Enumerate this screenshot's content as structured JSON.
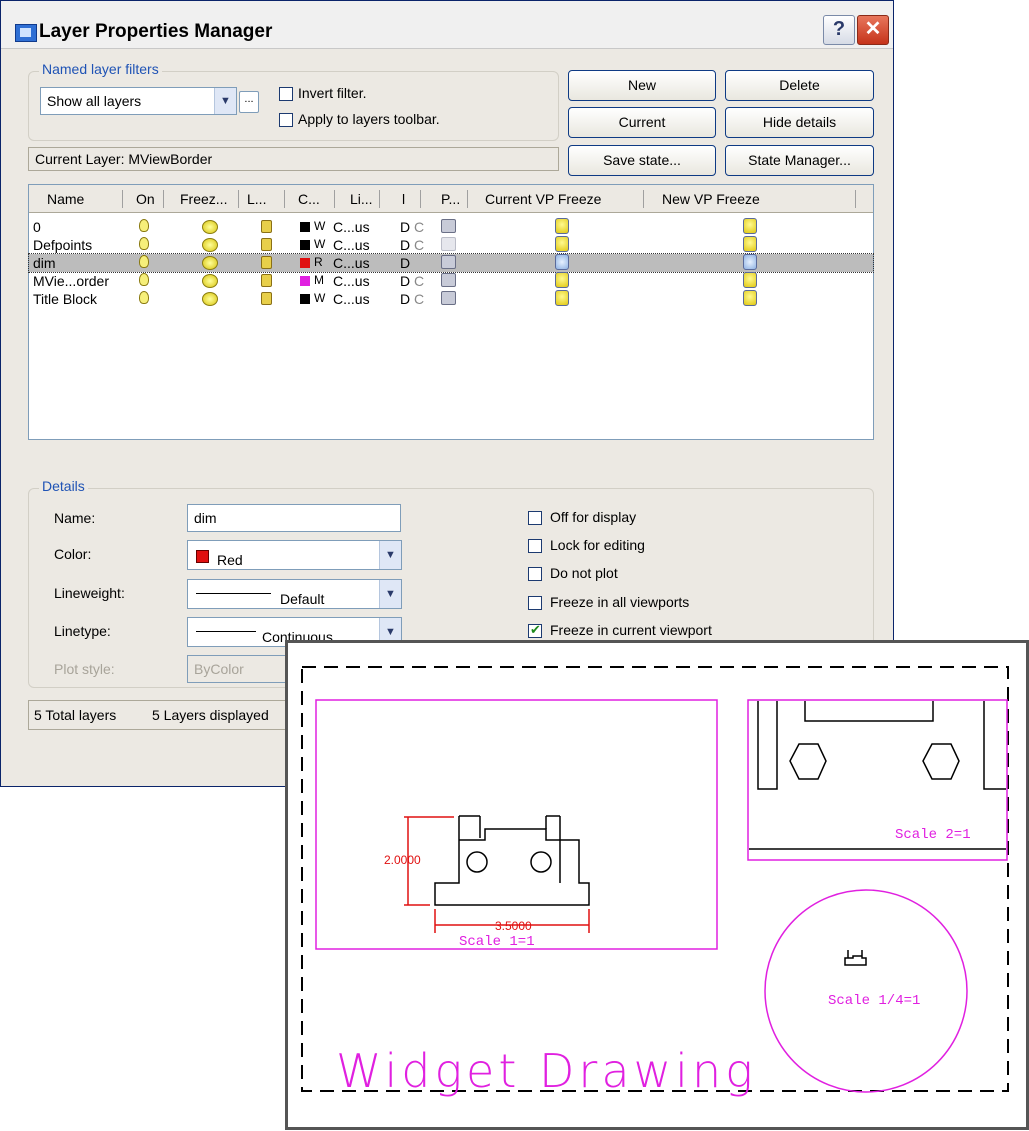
{
  "dialog": {
    "title": "Layer Properties Manager",
    "help": "?",
    "close": "✕"
  },
  "filters": {
    "group_label": "Named layer filters",
    "selected": "Show all layers",
    "invert_label": "Invert filter.",
    "apply_label": "Apply to layers toolbar."
  },
  "buttons": {
    "new": "New",
    "delete": "Delete",
    "current": "Current",
    "hide_details": "Hide details",
    "save_state": "Save state...",
    "state_manager": "State Manager..."
  },
  "current_layer": "Current Layer:  MViewBorder",
  "table": {
    "headers": [
      "Name",
      "On",
      "Freez...",
      "L...",
      "C...",
      "Li...",
      "l",
      "P...",
      "Current VP Freeze",
      "New VP Freeze"
    ],
    "rows": [
      {
        "name": "0",
        "color_letter": "W",
        "color": "#000000",
        "linetype": "C...us",
        "lw": "D",
        "pstyle": "C",
        "frozen_vp": false,
        "plot": true
      },
      {
        "name": "Defpoints",
        "color_letter": "W",
        "color": "#000000",
        "linetype": "C...us",
        "lw": "D",
        "pstyle": "C",
        "frozen_vp": false,
        "plot": false
      },
      {
        "name": "dim",
        "color_letter": "R",
        "color": "#e01010",
        "linetype": "C...us",
        "lw": "D",
        "pstyle": "",
        "frozen_vp": true,
        "plot": true
      },
      {
        "name": "MVie...order",
        "color_letter": "M",
        "color": "#e020e0",
        "linetype": "C...us",
        "lw": "D",
        "pstyle": "C",
        "frozen_vp": false,
        "plot": true
      },
      {
        "name": "Title Block",
        "color_letter": "W",
        "color": "#000000",
        "linetype": "C...us",
        "lw": "D",
        "pstyle": "C",
        "frozen_vp": false,
        "plot": true
      }
    ]
  },
  "details": {
    "group_label": "Details",
    "name_label": "Name:",
    "name_value": "dim",
    "color_label": "Color:",
    "color_value": "Red",
    "lineweight_label": "Lineweight:",
    "lineweight_value": "Default",
    "linetype_label": "Linetype:",
    "linetype_value": "Continuous",
    "plotstyle_label": "Plot style:",
    "plotstyle_value": "ByColor",
    "checks": [
      {
        "label": "Off for display",
        "checked": false
      },
      {
        "label": "Lock for editing",
        "checked": false
      },
      {
        "label": "Do not plot",
        "checked": false
      },
      {
        "label": "Freeze in all viewports",
        "checked": false
      },
      {
        "label": "Freeze in current viewport",
        "checked": true
      }
    ]
  },
  "status": {
    "total": "5 Total layers",
    "displayed": "5 Layers displayed"
  },
  "drawing": {
    "title": "Widget Drawing",
    "scale1": "Scale  1=1",
    "scale2": "Scale  2=1",
    "scale3": "Scale  1/4=1",
    "dim_height": "2.0000",
    "dim_width": "3.5000",
    "colors": {
      "viewport": "#e020e0",
      "dimension": "#e01010",
      "geometry": "#000000"
    }
  }
}
